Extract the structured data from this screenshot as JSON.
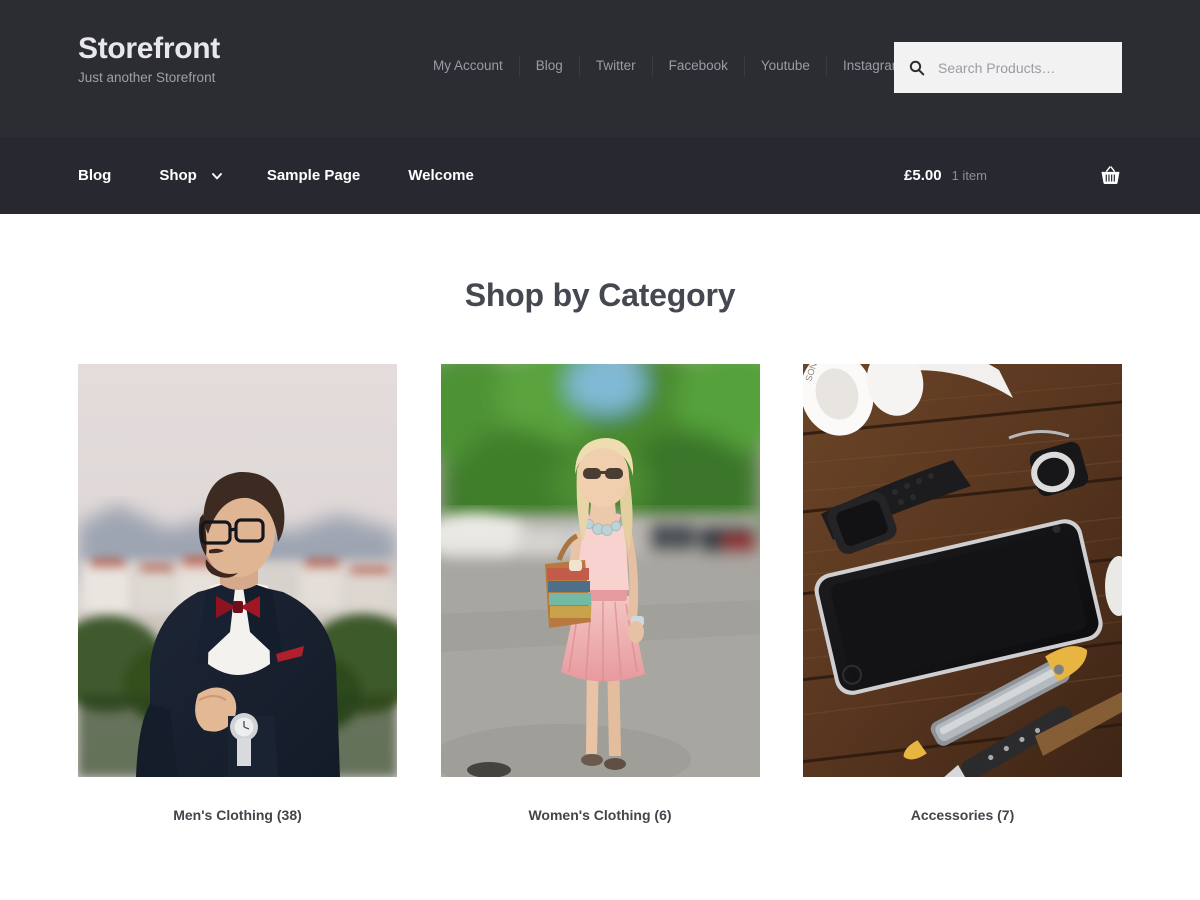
{
  "site": {
    "title": "Storefront",
    "tagline": "Just another Storefront"
  },
  "secondary_nav": {
    "items": [
      {
        "label": "My Account"
      },
      {
        "label": "Blog"
      },
      {
        "label": "Twitter"
      },
      {
        "label": "Facebook"
      },
      {
        "label": "Youtube"
      },
      {
        "label": "Instagram"
      }
    ]
  },
  "search": {
    "placeholder": "Search Products…",
    "value": "",
    "icon": "search-icon"
  },
  "main_nav": {
    "items": [
      {
        "label": "Blog",
        "has_children": false
      },
      {
        "label": "Shop",
        "has_children": true,
        "icon": "chevron-down-icon"
      },
      {
        "label": "Sample Page",
        "has_children": false
      },
      {
        "label": "Welcome",
        "has_children": false
      }
    ]
  },
  "cart": {
    "amount": "£5.00",
    "item_count": "1 item",
    "icon": "shopping-basket-icon"
  },
  "main": {
    "heading": "Shop by Category",
    "categories": [
      {
        "name": "Men's Clothing",
        "count": "(38)",
        "caption": "Men's Clothing (38)",
        "image_alt": "man-in-navy-suit-with-red-bow-tie"
      },
      {
        "name": "Women's Clothing",
        "count": "(6)",
        "caption": "Women's Clothing (6)",
        "image_alt": "woman-in-pink-dress-on-street"
      },
      {
        "name": "Accessories",
        "count": "(7)",
        "caption": "Accessories (7)",
        "image_alt": "phone-headphones-watch-on-wood"
      }
    ]
  },
  "colors": {
    "header_bg": "#2c2d33",
    "nav_bg": "#282930",
    "page_bg": "#ffffff",
    "heading": "#454851",
    "muted_text": "#9a9ca3",
    "search_bg": "#f2f2f2"
  }
}
